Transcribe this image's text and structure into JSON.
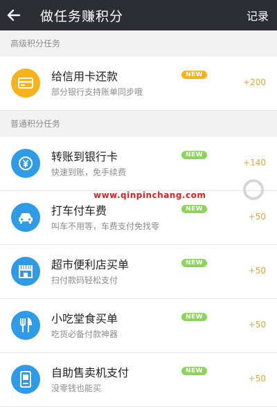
{
  "header": {
    "title": "做任务赚积分",
    "record_label": "记录"
  },
  "sections": [
    {
      "title": "高级积分任务"
    },
    {
      "title": "普通积分任务"
    }
  ],
  "tasks": [
    {
      "title": "给信用卡还款",
      "subtitle": "部分银行支持账单同步哦",
      "badge": "NEW",
      "points": "+200",
      "icon": "credit-card-icon"
    },
    {
      "title": "转账到银行卡",
      "subtitle": "快速到账，免手续费",
      "badge": "NEW",
      "points": "+140",
      "icon": "yen-transfer-icon"
    },
    {
      "title": "打车付车费",
      "subtitle": "叫车不用等，车费支付免找零",
      "badge": "NEW",
      "points": "+50",
      "icon": "car-icon"
    },
    {
      "title": "超市便利店买单",
      "subtitle": "扫付款码轻松支付",
      "badge": "NEW",
      "points": "+50",
      "icon": "store-icon"
    },
    {
      "title": "小吃堂食买单",
      "subtitle": "吃货必备付款神器",
      "badge": "NEW",
      "points": "+50",
      "icon": "fork-knife-icon"
    },
    {
      "title": "自助售卖机支付",
      "subtitle": "没零钱也能买",
      "badge": "NEW",
      "points": "+50",
      "icon": "vending-machine-icon"
    }
  ],
  "watermark": "www.qinpinchang.com",
  "colors": {
    "header_bg": "#2b2e36",
    "icon_blue": "#2f9be6",
    "icon_orange": "#f6b31b",
    "badge_green": "#8cd45c",
    "points": "#e6a54a"
  }
}
